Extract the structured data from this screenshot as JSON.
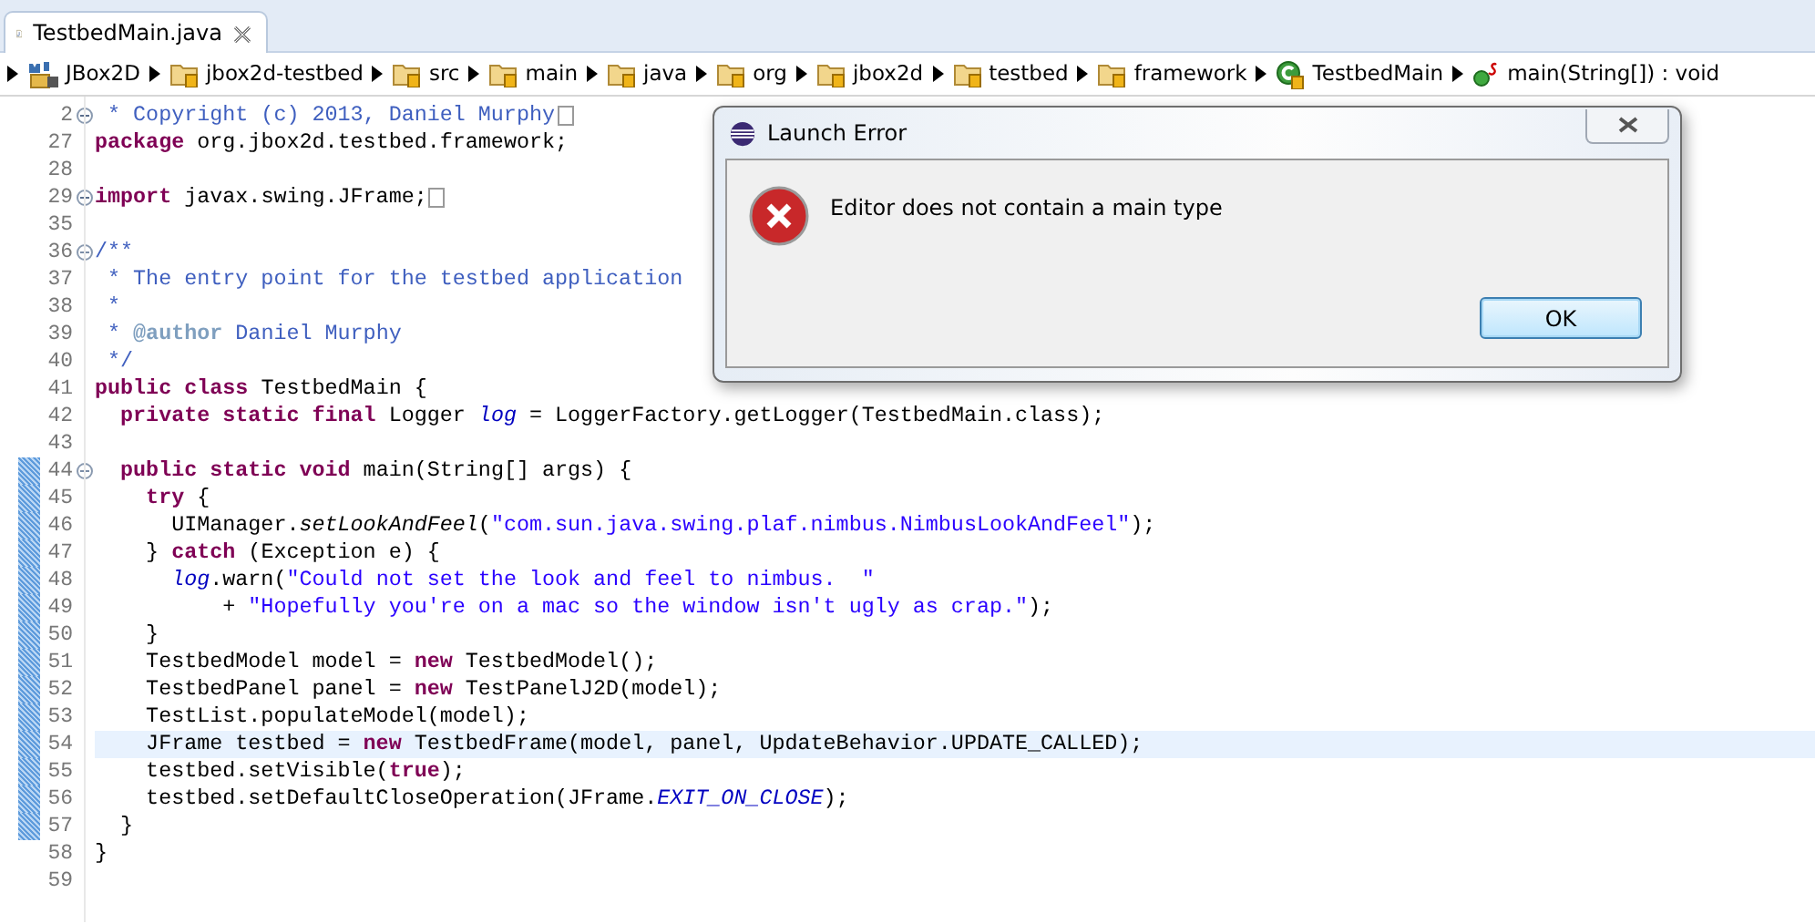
{
  "tabs": [
    {
      "label": "TestbedMain.java",
      "selected": true
    }
  ],
  "breadcrumb": [
    {
      "kind": "project",
      "label": "JBox2D"
    },
    {
      "kind": "folder",
      "label": "jbox2d-testbed"
    },
    {
      "kind": "folder",
      "label": "src"
    },
    {
      "kind": "folder",
      "label": "main"
    },
    {
      "kind": "folder",
      "label": "java"
    },
    {
      "kind": "folder",
      "label": "org"
    },
    {
      "kind": "folder",
      "label": "jbox2d"
    },
    {
      "kind": "folder",
      "label": "testbed"
    },
    {
      "kind": "folder",
      "label": "framework"
    },
    {
      "kind": "class",
      "label": "TestbedMain"
    },
    {
      "kind": "method",
      "label": "main(String[]) : void"
    }
  ],
  "code_lines": [
    {
      "number": "2",
      "folded": true,
      "collapsed_body": true,
      "changed": false,
      "current": false,
      "tokens": [
        {
          "kind": "comment",
          "text": " * Copyright (c) 2013, Daniel Murphy"
        }
      ]
    },
    {
      "number": "27",
      "collapsed_body": false,
      "changed": false,
      "current": false,
      "tokens": [
        {
          "kind": "keyword",
          "text": "package"
        },
        {
          "kind": "plain",
          "text": " org.jbox2d.testbed.framework;"
        }
      ]
    },
    {
      "number": "28",
      "collapsed_body": false,
      "changed": false,
      "current": false
    },
    {
      "number": "29",
      "folded": true,
      "collapsed_body": true,
      "changed": false,
      "current": false,
      "tokens": [
        {
          "kind": "keyword",
          "text": "import"
        },
        {
          "kind": "plain",
          "text": " javax.swing.JFrame;"
        }
      ]
    },
    {
      "number": "35",
      "collapsed_body": false,
      "changed": false,
      "current": false
    },
    {
      "number": "36",
      "folded": false,
      "collapsed_body": false,
      "changed": false,
      "current": false,
      "tokens": [
        {
          "kind": "comment",
          "text": "/**"
        }
      ]
    },
    {
      "number": "37",
      "collapsed_body": false,
      "changed": false,
      "current": false,
      "tokens": [
        {
          "kind": "comment",
          "text": " * The entry point for the testbed application"
        }
      ]
    },
    {
      "number": "38",
      "collapsed_body": false,
      "changed": false,
      "current": false,
      "tokens": [
        {
          "kind": "comment",
          "text": " *"
        }
      ]
    },
    {
      "number": "39",
      "collapsed_body": false,
      "changed": false,
      "current": false,
      "tokens": [
        {
          "kind": "comment",
          "text": " * "
        },
        {
          "kind": "doctag",
          "text": "@author"
        },
        {
          "kind": "comment",
          "text": " Daniel Murphy"
        }
      ]
    },
    {
      "number": "40",
      "collapsed_body": false,
      "changed": false,
      "current": false,
      "tokens": [
        {
          "kind": "comment",
          "text": " */"
        }
      ]
    },
    {
      "number": "41",
      "collapsed_body": false,
      "changed": false,
      "current": false,
      "tokens": [
        {
          "kind": "keyword",
          "text": "public "
        },
        {
          "kind": "keyword",
          "text": "class"
        },
        {
          "kind": "plain",
          "text": " TestbedMain {"
        }
      ]
    },
    {
      "number": "42",
      "collapsed_body": false,
      "changed": false,
      "current": false,
      "tokens": [
        {
          "kind": "keyword",
          "text": "  private "
        },
        {
          "kind": "keyword",
          "text": "static "
        },
        {
          "kind": "keyword",
          "text": "final"
        },
        {
          "kind": "plain",
          "text": " Logger "
        },
        {
          "kind": "field",
          "text": "log"
        },
        {
          "kind": "plain",
          "text": " = LoggerFactory.getLogger(TestbedMain.class);"
        }
      ]
    },
    {
      "number": "43",
      "collapsed_body": false,
      "changed": false,
      "current": false
    },
    {
      "number": "44",
      "folded": false,
      "collapsed_body": false,
      "changed": true,
      "current": false,
      "tokens": [
        {
          "kind": "keyword",
          "text": "  public "
        },
        {
          "kind": "keyword",
          "text": "static "
        },
        {
          "kind": "keyword",
          "text": "void"
        },
        {
          "kind": "plain",
          "text": " main(String[] args) {"
        }
      ]
    },
    {
      "number": "45",
      "collapsed_body": false,
      "changed": true,
      "current": false,
      "tokens": [
        {
          "kind": "keyword",
          "text": "    try"
        },
        {
          "kind": "plain",
          "text": " {"
        }
      ]
    },
    {
      "number": "46",
      "collapsed_body": false,
      "changed": true,
      "current": false,
      "tokens": [
        {
          "kind": "plain",
          "text": "      UIManager."
        },
        {
          "kind": "static_method",
          "text": "setLookAndFeel"
        },
        {
          "kind": "plain",
          "text": "("
        },
        {
          "kind": "string",
          "text": "\"com.sun.java.swing.plaf.nimbus.NimbusLookAndFeel\""
        },
        {
          "kind": "plain",
          "text": ");"
        }
      ]
    },
    {
      "number": "47",
      "collapsed_body": false,
      "changed": true,
      "current": false,
      "tokens": [
        {
          "kind": "plain",
          "text": "    } "
        },
        {
          "kind": "keyword",
          "text": "catch"
        },
        {
          "kind": "plain",
          "text": " (Exception e) {"
        }
      ]
    },
    {
      "number": "48",
      "collapsed_body": false,
      "changed": true,
      "current": false,
      "tokens": [
        {
          "kind": "field",
          "text": "      log"
        },
        {
          "kind": "plain",
          "text": ".warn("
        },
        {
          "kind": "string",
          "text": "\"Could not set the look and feel to nimbus.  \""
        }
      ]
    },
    {
      "number": "49",
      "collapsed_body": false,
      "changed": true,
      "current": false,
      "tokens": [
        {
          "kind": "plain",
          "text": "          + "
        },
        {
          "kind": "string",
          "text": "\"Hopefully you're on a mac so the window isn't ugly as crap.\""
        },
        {
          "kind": "plain",
          "text": ");"
        }
      ]
    },
    {
      "number": "50",
      "collapsed_body": false,
      "changed": true,
      "current": false,
      "tokens": [
        {
          "kind": "plain",
          "text": "    }"
        }
      ]
    },
    {
      "number": "51",
      "collapsed_body": false,
      "changed": true,
      "current": false,
      "tokens": [
        {
          "kind": "plain",
          "text": "    TestbedModel model = "
        },
        {
          "kind": "keyword",
          "text": "new"
        },
        {
          "kind": "plain",
          "text": " TestbedModel();"
        }
      ]
    },
    {
      "number": "52",
      "collapsed_body": false,
      "changed": true,
      "current": false,
      "tokens": [
        {
          "kind": "plain",
          "text": "    TestbedPanel panel = "
        },
        {
          "kind": "keyword",
          "text": "new"
        },
        {
          "kind": "plain",
          "text": " TestPanelJ2D(model);"
        }
      ]
    },
    {
      "number": "53",
      "collapsed_body": false,
      "changed": true,
      "current": false,
      "tokens": [
        {
          "kind": "plain",
          "text": "    TestList.populateModel(model);"
        }
      ]
    },
    {
      "number": "54",
      "collapsed_body": false,
      "changed": true,
      "current": true,
      "tokens": [
        {
          "kind": "plain",
          "text": "    JFrame testbed = "
        },
        {
          "kind": "keyword",
          "text": "new"
        },
        {
          "kind": "plain",
          "text": " TestbedFrame(model, panel, UpdateBehavior.UPDATE_CALLED);"
        }
      ]
    },
    {
      "number": "55",
      "collapsed_body": false,
      "changed": true,
      "current": false,
      "tokens": [
        {
          "kind": "plain",
          "text": "    testbed.setVisible("
        },
        {
          "kind": "keyword",
          "text": "true"
        },
        {
          "kind": "plain",
          "text": ");"
        }
      ]
    },
    {
      "number": "56",
      "collapsed_body": false,
      "changed": true,
      "current": false,
      "tokens": [
        {
          "kind": "plain",
          "text": "    testbed.setDefaultCloseOperation(JFrame."
        },
        {
          "kind": "field",
          "text": "EXIT_ON_CLOSE"
        },
        {
          "kind": "plain",
          "text": ");"
        }
      ]
    },
    {
      "number": "57",
      "collapsed_body": false,
      "changed": true,
      "current": false,
      "tokens": [
        {
          "kind": "plain",
          "text": "  }"
        }
      ]
    },
    {
      "number": "58",
      "collapsed_body": false,
      "changed": false,
      "current": false,
      "tokens": [
        {
          "kind": "plain",
          "text": "}"
        }
      ]
    },
    {
      "number": "59",
      "collapsed_body": false,
      "changed": false,
      "current": false
    }
  ],
  "dialog": {
    "title": "Launch Error",
    "message": "Editor does not contain a main type",
    "buttons": [
      "OK"
    ]
  }
}
